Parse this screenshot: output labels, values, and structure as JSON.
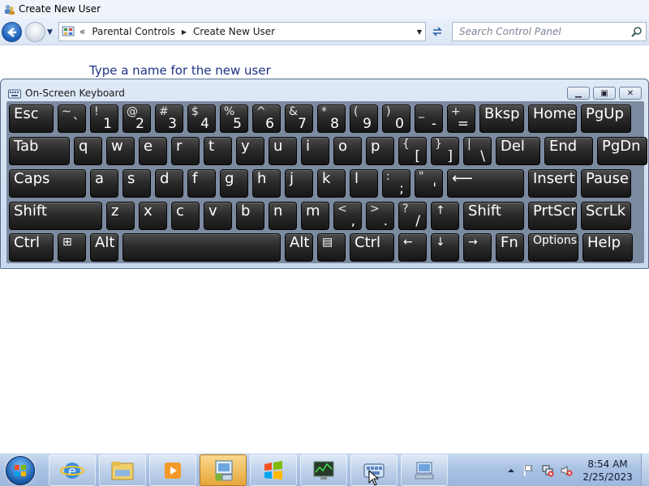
{
  "window": {
    "title": "Create New User"
  },
  "nav": {
    "history_marker": "«",
    "breadcrumb": [
      "Parental Controls",
      "Create New User"
    ],
    "search_placeholder": "Search Control Panel"
  },
  "main": {
    "heading": "Type a name for the new user"
  },
  "osk": {
    "title": "On-Screen Keyboard",
    "window_buttons": [
      "minimize",
      "maximize",
      "close"
    ],
    "rows": [
      [
        {
          "main": "Esc"
        },
        {
          "top": "~",
          "bot": "`"
        },
        {
          "top": "!",
          "bot": "1"
        },
        {
          "top": "@",
          "bot": "2"
        },
        {
          "top": "#",
          "bot": "3"
        },
        {
          "top": "$",
          "bot": "4"
        },
        {
          "top": "%",
          "bot": "5"
        },
        {
          "top": "^",
          "bot": "6"
        },
        {
          "top": "&",
          "bot": "7"
        },
        {
          "top": "*",
          "bot": "8"
        },
        {
          "top": "(",
          "bot": "9"
        },
        {
          "top": ")",
          "bot": "0"
        },
        {
          "top": "_",
          "bot": "-"
        },
        {
          "top": "+",
          "bot": "="
        },
        {
          "main": "Bksp"
        },
        {
          "main": "Home"
        },
        {
          "main": "PgUp"
        }
      ],
      [
        {
          "main": "Tab"
        },
        {
          "main": "q"
        },
        {
          "main": "w"
        },
        {
          "main": "e"
        },
        {
          "main": "r"
        },
        {
          "main": "t"
        },
        {
          "main": "y"
        },
        {
          "main": "u"
        },
        {
          "main": "i"
        },
        {
          "main": "o"
        },
        {
          "main": "p"
        },
        {
          "top": "{",
          "bot": "["
        },
        {
          "top": "}",
          "bot": "]"
        },
        {
          "top": "|",
          "bot": "\\"
        },
        {
          "main": "Del"
        },
        {
          "main": "End"
        },
        {
          "main": "PgDn"
        }
      ],
      [
        {
          "main": "Caps"
        },
        {
          "main": "a"
        },
        {
          "main": "s"
        },
        {
          "main": "d"
        },
        {
          "main": "f"
        },
        {
          "main": "g"
        },
        {
          "main": "h"
        },
        {
          "main": "j"
        },
        {
          "main": "k"
        },
        {
          "main": "l"
        },
        {
          "top": ":",
          "bot": ";"
        },
        {
          "top": "\"",
          "bot": "'"
        },
        {
          "main": "⟵"
        },
        {
          "main": "Insert"
        },
        {
          "main": "Pause"
        }
      ],
      [
        {
          "main": "Shift"
        },
        {
          "main": "z"
        },
        {
          "main": "x"
        },
        {
          "main": "c"
        },
        {
          "main": "v"
        },
        {
          "main": "b"
        },
        {
          "main": "n"
        },
        {
          "main": "m"
        },
        {
          "top": "<",
          "bot": ","
        },
        {
          "top": ">",
          "bot": "."
        },
        {
          "top": "?",
          "bot": "/"
        },
        {
          "main": "↑"
        },
        {
          "main": "Shift"
        },
        {
          "main": "PrtScn"
        },
        {
          "main": "ScrLk"
        }
      ],
      [
        {
          "main": "Ctrl"
        },
        {
          "main": "⊞"
        },
        {
          "main": "Alt"
        },
        {
          "main": ""
        },
        {
          "main": "Alt"
        },
        {
          "main": "▤"
        },
        {
          "main": "Ctrl"
        },
        {
          "main": "←"
        },
        {
          "main": "↓"
        },
        {
          "main": "→"
        },
        {
          "main": "Fn"
        },
        {
          "main": "Options"
        },
        {
          "main": "Help"
        }
      ]
    ]
  },
  "taskbar": {
    "buttons": [
      "internet-explorer",
      "windows-explorer",
      "media-player",
      "control-panel",
      "windows",
      "performance-monitor",
      "on-screen-keyboard",
      "network"
    ],
    "active_index": 3,
    "clock_time": "8:54 AM",
    "clock_date": "2/25/2023"
  },
  "colors": {
    "heading": "#1e3287",
    "key_bg": "#1f1f1f",
    "osk_frame": "#c8d8ee",
    "taskbar": "#a9c2e3"
  }
}
